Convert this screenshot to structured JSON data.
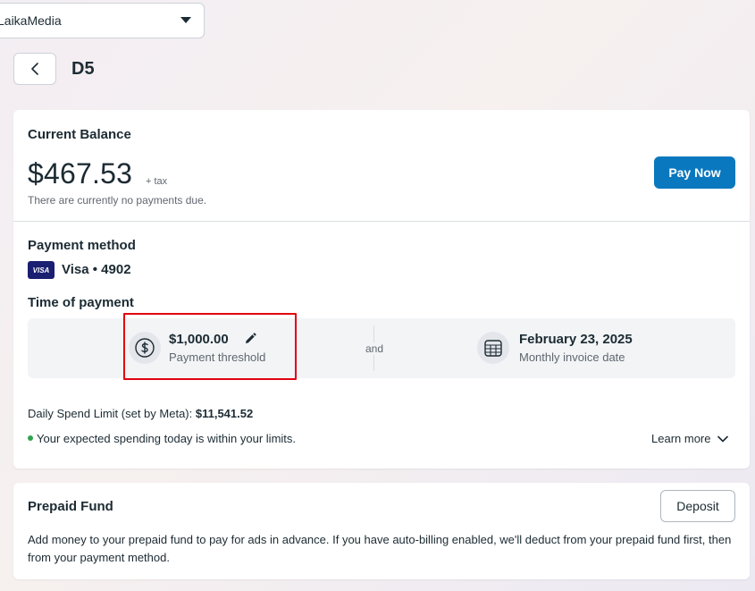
{
  "account_selector": {
    "label": "LaikaMedia",
    "icon": "chevron-down-icon"
  },
  "header": {
    "back_icon": "chevron-left-icon",
    "title": "D5"
  },
  "balance": {
    "heading": "Current Balance",
    "amount": "$467.53",
    "tax_note": "+ tax",
    "status": "There are currently no payments due.",
    "pay_button": "Pay Now"
  },
  "payment_method": {
    "heading": "Payment method",
    "card_brand_badge": "VISA",
    "card_label": "Visa • 4902"
  },
  "time_of_payment": {
    "heading": "Time of payment",
    "threshold": {
      "amount": "$1,000.00",
      "label": "Payment threshold",
      "icon": "dollar-circle-icon",
      "edit_icon": "pencil-icon"
    },
    "connector": "and",
    "invoice": {
      "date": "February 23, 2025",
      "label": "Monthly invoice date",
      "icon": "calendar-icon"
    }
  },
  "spend_limit": {
    "label": "Daily Spend Limit (set by Meta):",
    "value": "$11,541.52",
    "status_text": "Your expected spending today is within your limits.",
    "learn_more": "Learn more"
  },
  "prepaid_fund": {
    "heading": "Prepaid Fund",
    "deposit_button": "Deposit",
    "description": "Add money to your prepaid fund to pay for ads in advance. If you have auto-billing enabled, we'll deduct from your prepaid fund first, then from your payment method."
  },
  "colors": {
    "primary": "#0a78be",
    "highlight": "#e3000f",
    "status_ok": "#31a24c",
    "visa": "#1a1f71"
  }
}
